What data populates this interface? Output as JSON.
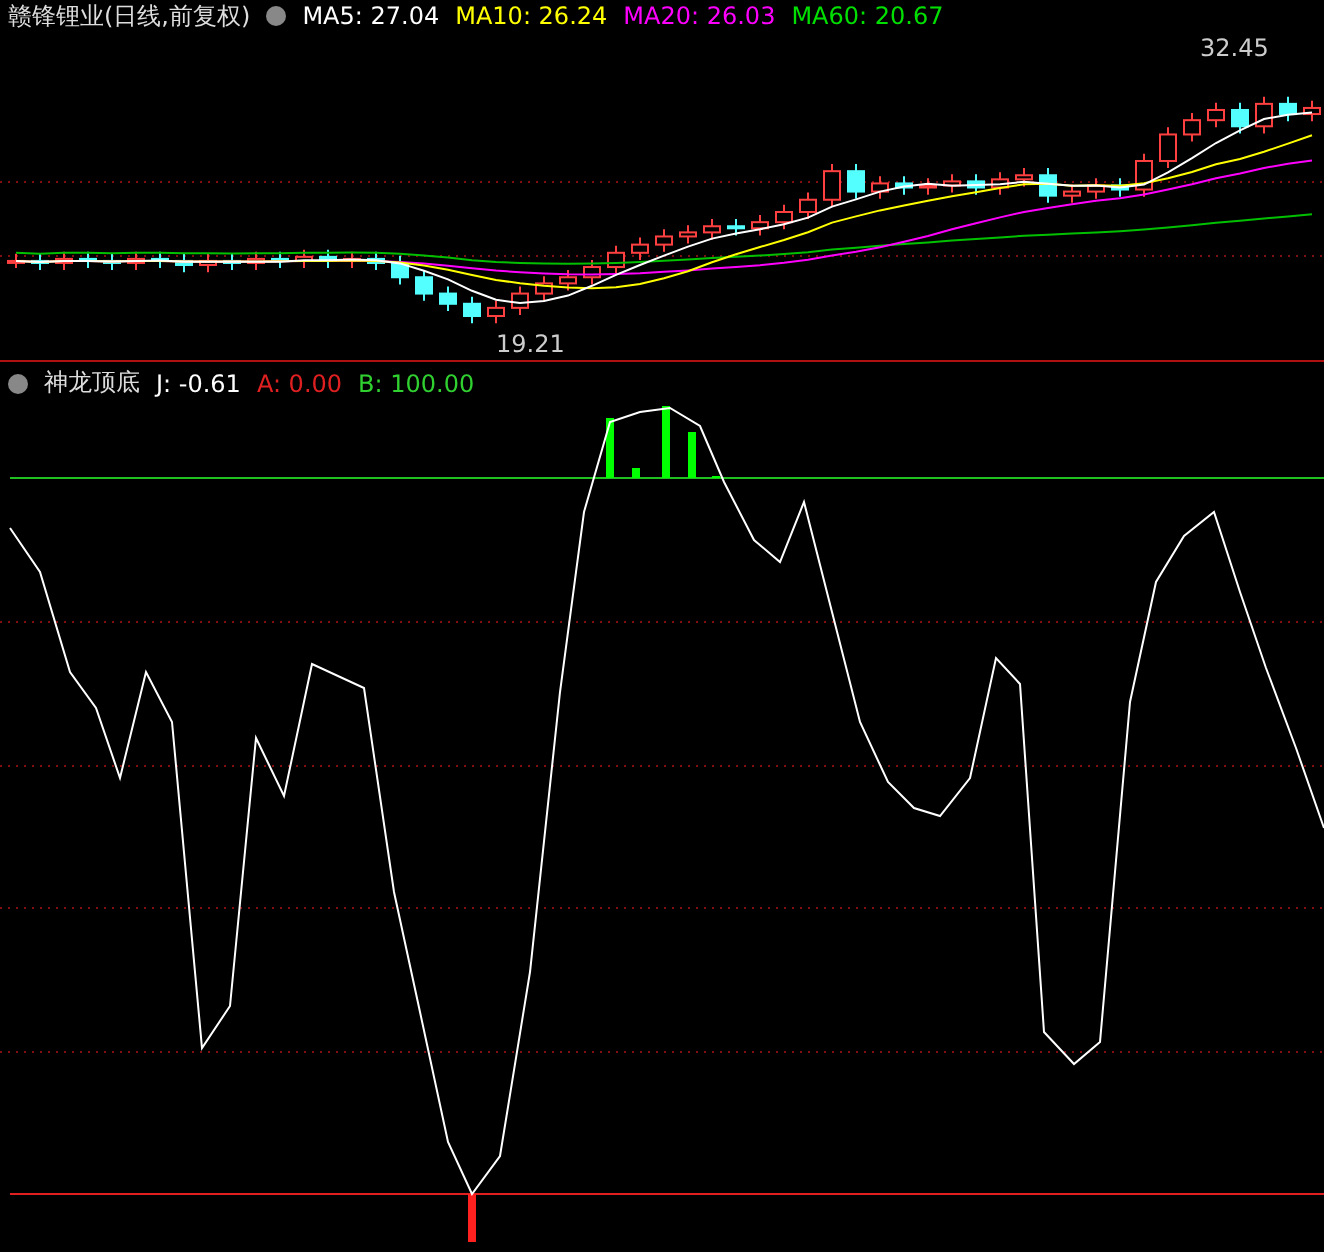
{
  "main_chart": {
    "title": "赣锋锂业(日线,前复权)",
    "indicators": [
      {
        "text": "MA5: 27.04",
        "color": "#ffffff"
      },
      {
        "text": "MA10: 26.24",
        "color": "#ffff00"
      },
      {
        "text": "MA20: 26.03",
        "color": "#ff00ff"
      },
      {
        "text": "MA60: 20.67",
        "color": "#00e000"
      }
    ],
    "high_label": "32.45",
    "low_label": "19.21"
  },
  "indicator_panel": {
    "title": "神龙顶底",
    "readings": [
      {
        "text": "J: -0.61",
        "color": "#ffffff"
      },
      {
        "text": "A: 0.00",
        "color": "#e02020"
      },
      {
        "text": "B: 100.00",
        "color": "#30d030"
      }
    ]
  }
}
